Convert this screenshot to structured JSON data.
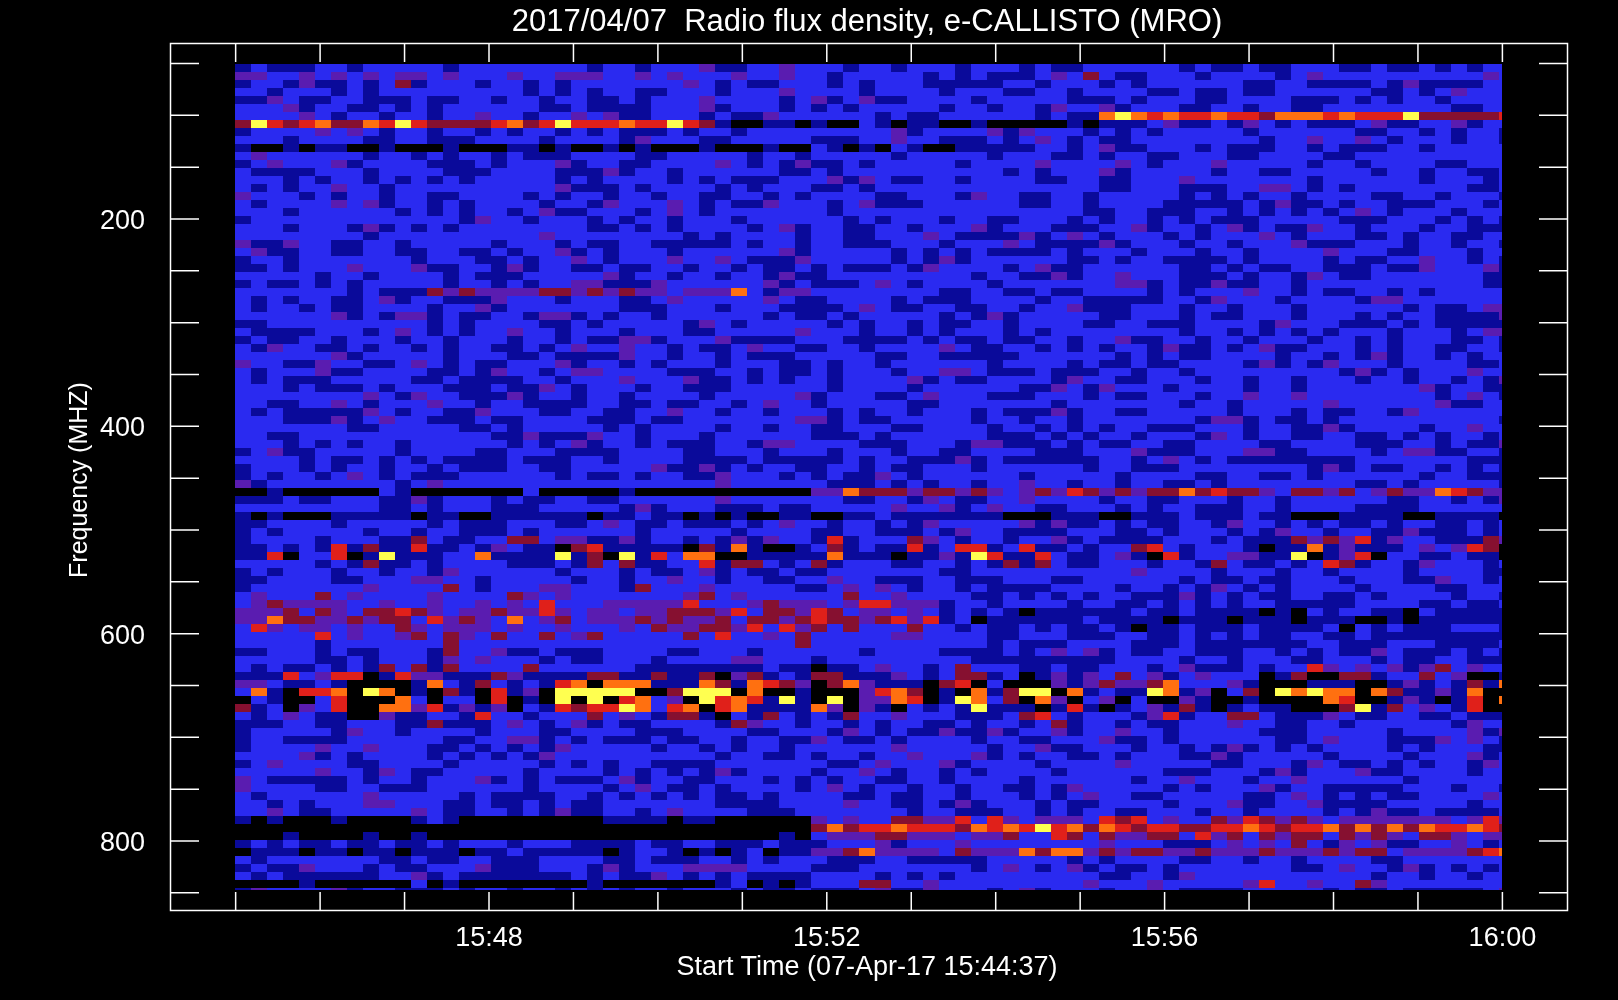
{
  "title": "2017/04/07  Radio flux density, e-CALLISTO (MRO)",
  "y_axis": {
    "label": "Frequency (MHZ)",
    "tick_labels": [
      "200",
      "400",
      "600",
      "800"
    ]
  },
  "x_axis": {
    "label": "Start Time (07-Apr-17 15:44:37)",
    "tick_labels": [
      "15:48",
      "15:52",
      "15:56",
      "16:00"
    ]
  }
}
